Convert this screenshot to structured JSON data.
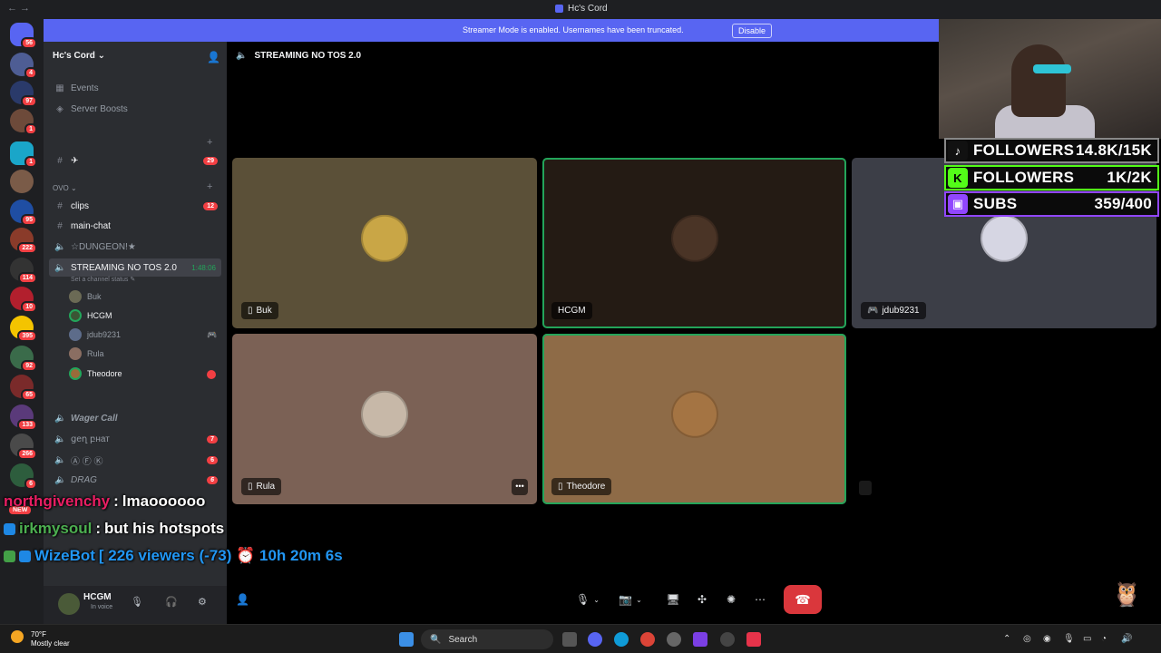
{
  "window": {
    "title": "Hc's Cord",
    "nav": "←  →"
  },
  "banner": {
    "text": "Streamer Mode is enabled. Usernames have been truncated.",
    "button": "Disable"
  },
  "server_rail": {
    "badges": [
      "56",
      "4",
      "97",
      "1",
      "1",
      "95",
      "222",
      "114",
      "10",
      "395",
      "92",
      "65",
      "133",
      "266",
      "6"
    ],
    "new_label": "NEW"
  },
  "sidebar": {
    "server_name": "Hc's Cord",
    "items": [
      {
        "label": "Events",
        "icon": "calendar-icon"
      },
      {
        "label": "Server Boosts",
        "icon": "boost-icon"
      }
    ],
    "category_ovo": "OVO",
    "channels": [
      {
        "label": "✈",
        "count": "29"
      },
      {
        "label": "clips",
        "count": "12"
      },
      {
        "label": "main-chat",
        "count": ""
      },
      {
        "label": "☆DUNGEON!★",
        "count": ""
      }
    ],
    "voice_channel": {
      "name": "STREAMING NO TOS 2.0",
      "timer": "1:48:06",
      "status": "Set a channel status"
    },
    "voice_users": [
      {
        "name": "Buk",
        "color": "#6b6a55"
      },
      {
        "name": "HCGM",
        "color": "#3b5534"
      },
      {
        "name": "jdub9231",
        "color": "#5d6c8a"
      },
      {
        "name": "Rula",
        "color": "#8a6e62"
      },
      {
        "name": "Theodore",
        "color": "#9b6b3a"
      }
    ],
    "lower_channels": [
      {
        "label": "Wager Call",
        "count": ""
      },
      {
        "label": "ցеղ բнат",
        "count": "7"
      },
      {
        "label": "Ⓐ Ⓕ Ⓚ",
        "count": "6"
      },
      {
        "label": "DRAG",
        "count": "6"
      }
    ]
  },
  "user_panel": {
    "name": "HCGM",
    "status": "In voice"
  },
  "call": {
    "channel_title": "STREAMING NO TOS 2.0",
    "tiles": [
      {
        "name": "Buk",
        "bg": "#5b5038",
        "avatar": "#c9a646",
        "speaking": false,
        "device": "mobile"
      },
      {
        "name": "HCGM",
        "bg": "#241b14",
        "avatar": "#4a3426",
        "speaking": true,
        "device": ""
      },
      {
        "name": "jdub9231",
        "bg": "#3c3e47",
        "avatar": "#d6d6e3",
        "speaking": false,
        "device": "console"
      },
      {
        "name": "Rula",
        "bg": "#7b6155",
        "avatar": "#c7b8a8",
        "speaking": false,
        "device": "mobile"
      },
      {
        "name": "Theodore",
        "bg": "#8e6b47",
        "avatar": "#a47443",
        "speaking": true,
        "device": "mobile"
      }
    ]
  },
  "stream_overlay": {
    "stats": [
      {
        "icon": "tiktok-icon",
        "label": "FOLLOWERS",
        "value": "14.8K/15K",
        "color": "#e0e0e0"
      },
      {
        "icon": "kick-icon",
        "label": "FOLLOWERS",
        "value": "1K/2K",
        "color": "#53fc18"
      },
      {
        "icon": "twitch-icon",
        "label": "SUBS",
        "value": "359/400",
        "color": "#9146ff"
      }
    ],
    "chat": [
      {
        "user": "northgivenchy",
        "message": "lmaoooooo",
        "user_color": "#e91e63"
      },
      {
        "user": "irkmysoul",
        "message": "but his hotspots",
        "user_color": "#4caf50"
      },
      {
        "user": "WizeBot",
        "message": "[ 226 viewers (-73) ⏰ 10h 20m 6s",
        "user_color": "#2196f3"
      }
    ]
  },
  "taskbar": {
    "weather_temp": "70°F",
    "weather_desc": "Mostly clear",
    "search": "Search"
  }
}
